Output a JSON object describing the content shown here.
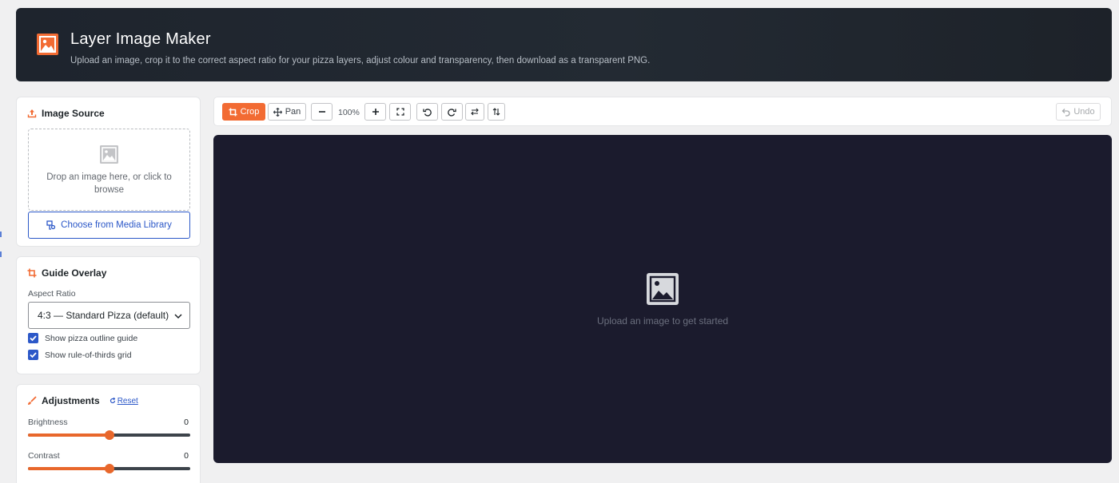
{
  "header": {
    "title": "Layer Image Maker",
    "subtitle": "Upload an image, crop it to the correct aspect ratio for your pizza layers, adjust colour and transparency, then download as a transparent PNG."
  },
  "image_source": {
    "title": "Image Source",
    "dropzone_text": "Drop an image here, or click to browse",
    "media_library_label": "Choose from Media Library"
  },
  "guide_overlay": {
    "title": "Guide Overlay",
    "aspect_ratio_label": "Aspect Ratio",
    "aspect_ratio_value": "4:3 — Standard Pizza (default)",
    "show_outline_label": "Show pizza outline guide",
    "show_outline_checked": true,
    "show_grid_label": "Show rule-of-thirds grid",
    "show_grid_checked": true
  },
  "adjustments": {
    "title": "Adjustments",
    "reset_label": "Reset",
    "sliders": [
      {
        "label": "Brightness",
        "value": "0",
        "fraction": 0.5
      },
      {
        "label": "Contrast",
        "value": "0",
        "fraction": 0.5
      }
    ]
  },
  "toolbar": {
    "crop_label": "Crop",
    "pan_label": "Pan",
    "zoom_level": "100%",
    "undo_label": "Undo"
  },
  "canvas": {
    "empty_text": "Upload an image to get started"
  },
  "colors": {
    "accent": "#f26b33",
    "link": "#2c58c8",
    "canvas_bg": "#1b1b2d",
    "header_bg": "#1e242d"
  },
  "icons": {
    "logo": "image-icon",
    "upload": "upload-icon",
    "media": "media-library-icon",
    "crop": "crop-icon",
    "pan": "move-icon",
    "zoom_out": "minus-icon",
    "zoom_in": "plus-icon",
    "fit": "fit-screen-icon",
    "rotate_left": "rotate-left-icon",
    "rotate_right": "rotate-right-icon",
    "flip_h": "flip-horizontal-icon",
    "flip_v": "flip-vertical-icon",
    "undo": "undo-icon",
    "adjust": "brush-icon"
  }
}
